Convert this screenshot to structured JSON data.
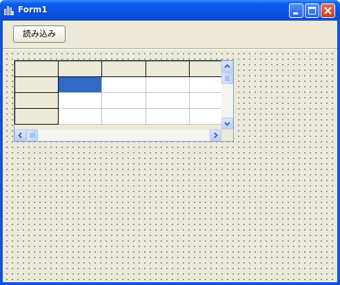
{
  "window": {
    "title": "Form1",
    "icons": {
      "app": "form-app-icon",
      "minimize": "minimize-icon",
      "maximize": "maximize-icon",
      "close": "close-icon"
    }
  },
  "toolbar": {
    "load_label": "読み込み"
  },
  "grid": {
    "columns": 5,
    "rows": 3,
    "selected_cell": {
      "row": 1,
      "column": 1
    },
    "selection_color": "#316ac5",
    "cells": [
      [
        "",
        "",
        "",
        ""
      ],
      [
        "",
        "",
        "",
        ""
      ],
      [
        "",
        "",
        "",
        ""
      ]
    ]
  },
  "colors": {
    "titlebar": "#0a5df2",
    "form_background": "#ece9d8",
    "close_button": "#c43e1d"
  }
}
